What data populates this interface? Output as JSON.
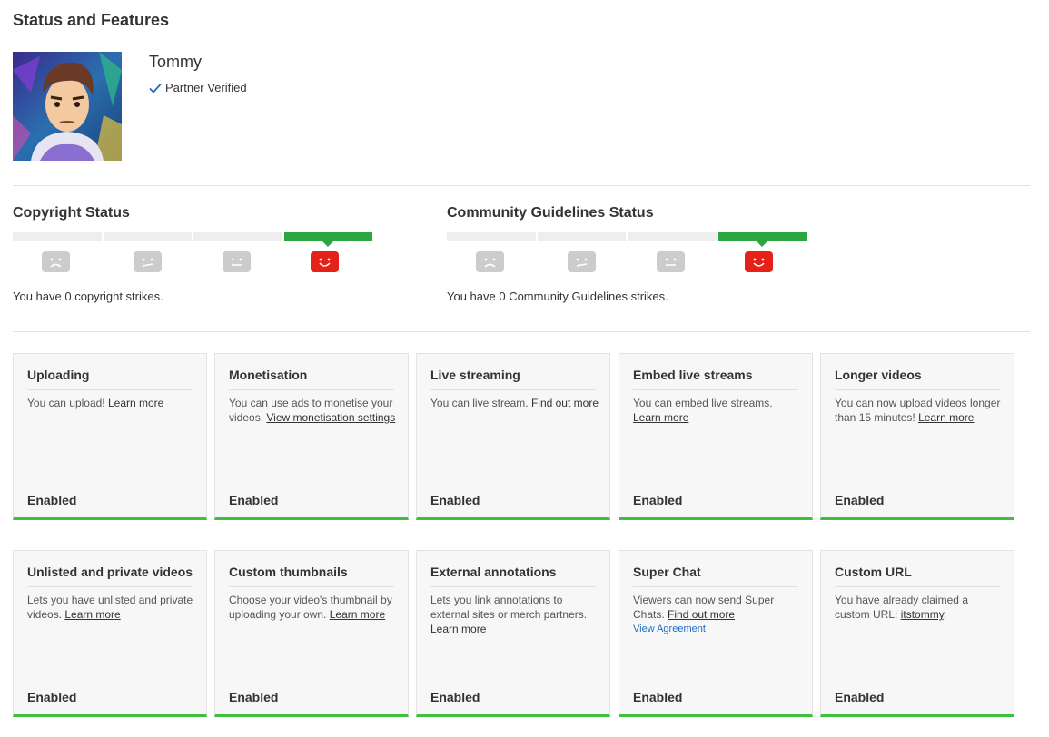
{
  "page": {
    "title": "Status and Features"
  },
  "channel": {
    "name": "Tommy",
    "badge": "Partner Verified"
  },
  "copyright": {
    "title": "Copyright Status",
    "text": "You have 0 copyright strikes."
  },
  "community": {
    "title": "Community Guidelines Status",
    "text": "You have 0 Community Guidelines strikes."
  },
  "colors": {
    "enabled_bar": "#3ec03e",
    "active_strike": "#2ba640",
    "active_face": "#e62117",
    "inactive_face": "#cccccc",
    "link_blue": "#1e6ec6"
  },
  "features": [
    {
      "title": "Uploading",
      "desc": "You can upload! ",
      "link": "Learn more",
      "status": "Enabled"
    },
    {
      "title": "Monetisation",
      "desc": "You can use ads to monetise your videos. ",
      "link": "View monetisation settings",
      "status": "Enabled"
    },
    {
      "title": "Live streaming",
      "desc": "You can live stream. ",
      "link": "Find out more",
      "status": "Enabled"
    },
    {
      "title": "Embed live streams",
      "desc": "You can embed live streams. ",
      "link": "Learn more",
      "status": "Enabled"
    },
    {
      "title": "Longer videos",
      "desc": "You can now upload videos longer than 15 minutes! ",
      "link": "Learn more",
      "status": "Enabled"
    },
    {
      "title": "Unlisted and private videos",
      "desc": "Lets you have unlisted and private videos. ",
      "link": "Learn more",
      "status": "Enabled"
    },
    {
      "title": "Custom thumbnails",
      "desc": "Choose your video's thumbnail by uploading your own. ",
      "link": "Learn more",
      "status": "Enabled"
    },
    {
      "title": "External annotations",
      "desc": "Lets you link annotations to external sites or merch partners. ",
      "link": "Learn more",
      "status": "Enabled"
    },
    {
      "title": "Super Chat",
      "desc": "Viewers can now send Super Chats. ",
      "link": "Find out more",
      "extra_link": "View Agreement",
      "status": "Enabled"
    },
    {
      "title": "Custom URL",
      "desc": "You have already claimed a custom URL: ",
      "link": "itstommy",
      "suffix": ".",
      "status": "Enabled"
    }
  ]
}
